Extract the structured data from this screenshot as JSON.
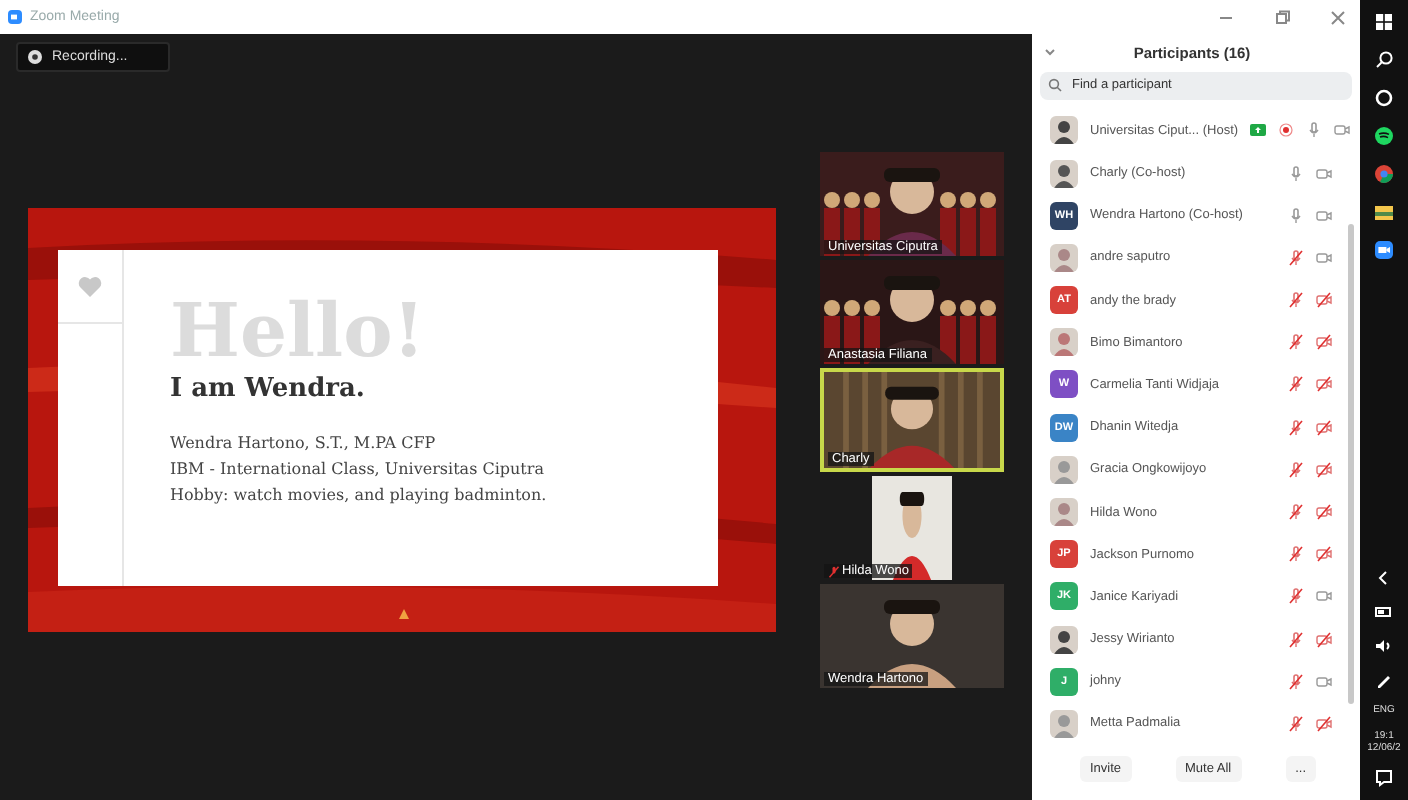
{
  "window": {
    "title": "Zoom Meeting"
  },
  "recording": {
    "label": "Recording..."
  },
  "slide": {
    "title": "Hello!",
    "subtitle": "I am Wendra.",
    "lines": [
      "Wendra Hartono, S.T., M.PA CFP",
      "IBM - International Class, Universitas Ciputra",
      "Hobby: watch movies, and playing badminton."
    ]
  },
  "videos": [
    {
      "name": "Universitas Ciputra",
      "kind": "wide",
      "speaking": false,
      "muted": false
    },
    {
      "name": "Anastasia Filiana",
      "kind": "wide",
      "speaking": false,
      "muted": false
    },
    {
      "name": "Charly",
      "kind": "wide",
      "speaking": true,
      "muted": false
    },
    {
      "name": "Hilda Wono",
      "kind": "portrait",
      "speaking": false,
      "muted": true
    },
    {
      "name": "Wendra Hartono",
      "kind": "wide",
      "speaking": false,
      "muted": false
    }
  ],
  "participants": {
    "title": "Participants (16)",
    "search": {
      "placeholder": "Find a participant"
    },
    "items": [
      {
        "name": "Universitas Ciput... (Host)",
        "kind": "picture",
        "sharing": true,
        "recording": true,
        "muted": false,
        "video_off": false
      },
      {
        "name": "Charly (Co-host)",
        "kind": "picture",
        "sharing": false,
        "recording": false,
        "muted": false,
        "video_off": false
      },
      {
        "name": "Wendra Hartono (Co-host)",
        "kind": "initials",
        "initials": "WH",
        "color": "#2f4464",
        "sharing": false,
        "recording": false,
        "muted": false,
        "video_off": false
      },
      {
        "name": "andre saputro",
        "kind": "picture",
        "sharing": false,
        "recording": false,
        "muted": true,
        "video_off": false
      },
      {
        "name": "andy the brady",
        "kind": "initials",
        "initials": "AT",
        "color": "#d8413a",
        "sharing": false,
        "recording": false,
        "muted": true,
        "video_off": true
      },
      {
        "name": "Bimo Bimantoro",
        "kind": "picture",
        "sharing": false,
        "recording": false,
        "muted": true,
        "video_off": true
      },
      {
        "name": "Carmelia Tanti Widjaja",
        "kind": "initials",
        "initials": "W",
        "color": "#7e4fc4",
        "sharing": false,
        "recording": false,
        "muted": true,
        "video_off": true
      },
      {
        "name": "Dhanin Witedja",
        "kind": "initials",
        "initials": "DW",
        "color": "#3a84c6",
        "sharing": false,
        "recording": false,
        "muted": true,
        "video_off": true
      },
      {
        "name": "Gracia Ongkowijoyo",
        "kind": "picture",
        "sharing": false,
        "recording": false,
        "muted": true,
        "video_off": true
      },
      {
        "name": "Hilda Wono",
        "kind": "picture",
        "sharing": false,
        "recording": false,
        "muted": true,
        "video_off": true
      },
      {
        "name": "Jackson Purnomo",
        "kind": "initials",
        "initials": "JP",
        "color": "#d8413a",
        "sharing": false,
        "recording": false,
        "muted": true,
        "video_off": true
      },
      {
        "name": "Janice Kariyadi",
        "kind": "initials",
        "initials": "JK",
        "color": "#2fae68",
        "sharing": false,
        "recording": false,
        "muted": true,
        "video_off": false
      },
      {
        "name": "Jessy Wirianto",
        "kind": "picture",
        "sharing": false,
        "recording": false,
        "muted": true,
        "video_off": true
      },
      {
        "name": "johny",
        "kind": "initials",
        "initials": "J",
        "color": "#2fae68",
        "sharing": false,
        "recording": false,
        "muted": true,
        "video_off": false
      },
      {
        "name": "Metta Padmalia",
        "kind": "picture",
        "sharing": false,
        "recording": false,
        "muted": true,
        "video_off": true
      }
    ],
    "buttons": [
      "Invite",
      "Mute All",
      "..."
    ]
  },
  "taskbar": {
    "language": "ENG",
    "time": "19:1",
    "date": "12/06/2"
  }
}
